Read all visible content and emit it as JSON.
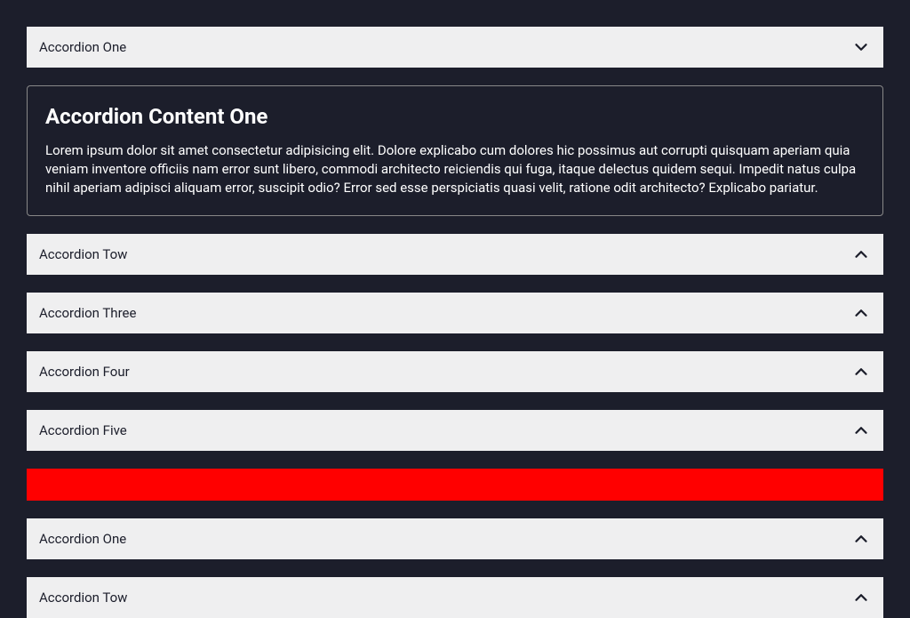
{
  "group1": {
    "items": [
      {
        "label": "Accordion One",
        "chevron": "down",
        "expanded": true,
        "contentTitle": "Accordion Content One",
        "contentBody": "Lorem ipsum dolor sit amet consectetur adipisicing elit. Dolore explicabo cum dolores hic possimus aut corrupti quisquam aperiam quia veniam inventore officiis nam error sunt libero, commodi architecto reiciendis qui fuga, itaque delectus quidem sequi. Impedit natus culpa nihil aperiam adipisci aliquam error, suscipit odio? Error sed esse perspiciatis quasi velit, ratione odit architecto? Explicabo pariatur."
      },
      {
        "label": "Accordion Tow",
        "chevron": "up",
        "expanded": false
      },
      {
        "label": "Accordion Three",
        "chevron": "up",
        "expanded": false
      },
      {
        "label": "Accordion Four",
        "chevron": "up",
        "expanded": false
      },
      {
        "label": "Accordion Five",
        "chevron": "up",
        "expanded": false
      }
    ]
  },
  "group2": {
    "items": [
      {
        "label": "Accordion One",
        "chevron": "up",
        "expanded": false
      },
      {
        "label": "Accordion Tow",
        "chevron": "up",
        "expanded": false
      }
    ]
  }
}
